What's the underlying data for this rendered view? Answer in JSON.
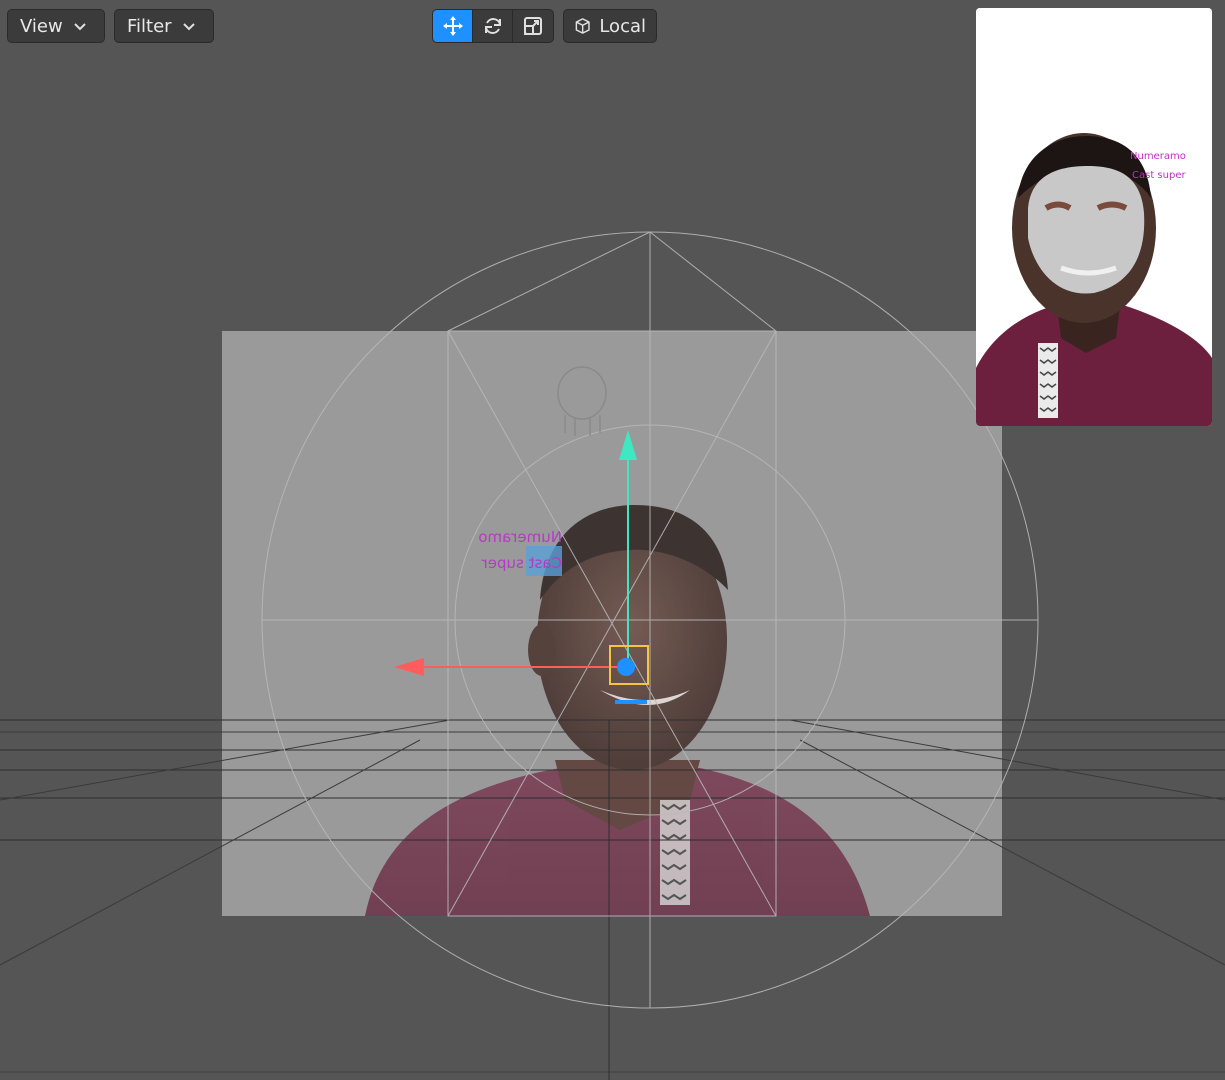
{
  "toolbar": {
    "view_label": "View",
    "filter_label": "Filter",
    "transform_modes": [
      "move-icon",
      "rotate-icon",
      "scale-icon"
    ],
    "active_mode": "move-icon",
    "space_label": "Local",
    "space_icon": "cube-icon"
  },
  "scene": {
    "mirrored_text_line1": "Numeramo",
    "mirrored_text_line2": "Cast super",
    "gizmo_colors": {
      "x_axis": "#ff5c5c",
      "y_axis": "#3fe8c0",
      "center": "#1e90ff",
      "selection_box": "#f5c542"
    }
  },
  "preview": {
    "text_line1": "Numeramo",
    "text_line2": "Cast super",
    "text_color": "#c02fc8"
  }
}
